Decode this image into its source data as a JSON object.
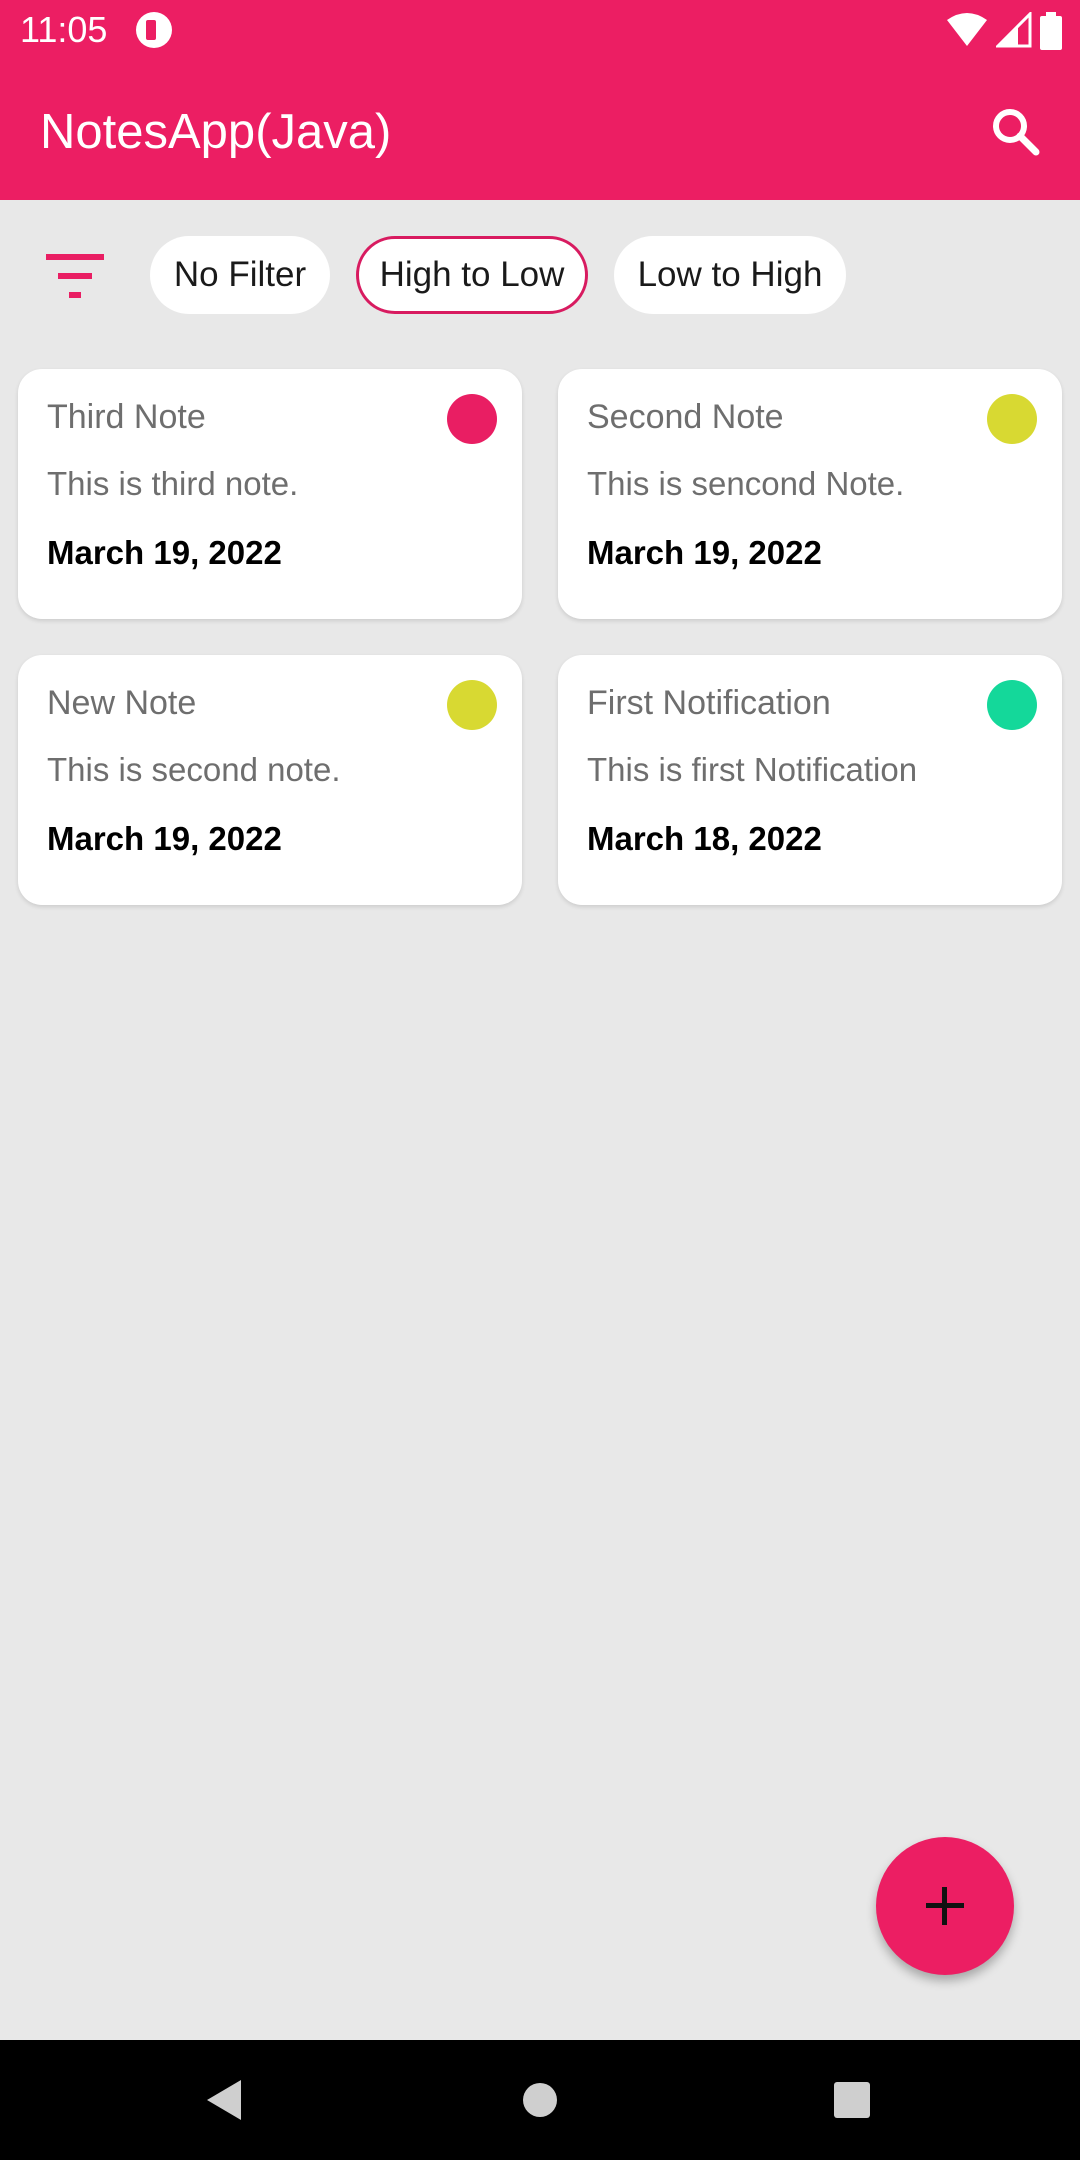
{
  "status_bar": {
    "time": "11:05",
    "icons": [
      "app-notification-icon",
      "wifi-icon",
      "signal-icon",
      "battery-icon"
    ]
  },
  "app_bar": {
    "title": "NotesApp(Java)",
    "search_icon": "search-icon",
    "color": "#ec1e63"
  },
  "filters": {
    "icon": "filter-icon",
    "chips": [
      {
        "label": "No Filter",
        "selected": false
      },
      {
        "label": "High to Low",
        "selected": true
      },
      {
        "label": "Low to High",
        "selected": false
      }
    ]
  },
  "notes": [
    {
      "title": "Third Note",
      "body": "This is third note.",
      "date": "March 19, 2022",
      "priority_color": "#e91e63"
    },
    {
      "title": "Second Note",
      "body": "This is sencond Note.",
      "date": "March 19, 2022",
      "priority_color": "#d8d932"
    },
    {
      "title": "New Note",
      "body": "This is second note.",
      "date": "March 19, 2022",
      "priority_color": "#d8d932"
    },
    {
      "title": "First Notification",
      "body": "This is first Notification",
      "date": "March 18, 2022",
      "priority_color": "#14d89a"
    }
  ],
  "fab": {
    "icon": "plus-icon"
  },
  "nav_bar": {
    "icons": [
      "back-icon",
      "home-icon",
      "recents-icon"
    ]
  }
}
